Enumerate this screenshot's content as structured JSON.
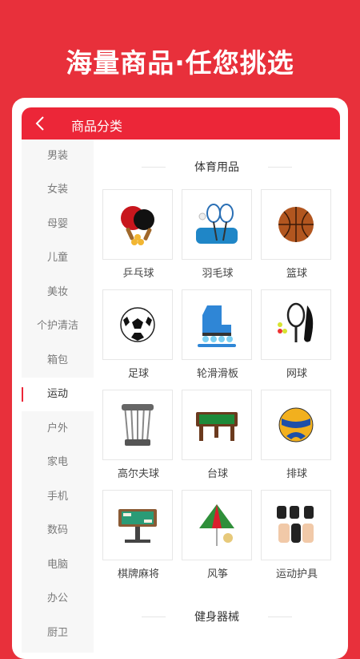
{
  "promo_text": "海量商品·任您挑选",
  "header": {
    "title": "商品分类"
  },
  "sidebar": {
    "items": [
      {
        "label": "男装"
      },
      {
        "label": "女装"
      },
      {
        "label": "母婴"
      },
      {
        "label": "儿童"
      },
      {
        "label": "美妆"
      },
      {
        "label": "个护清洁"
      },
      {
        "label": "箱包"
      },
      {
        "label": "运动",
        "active": true
      },
      {
        "label": "户外"
      },
      {
        "label": "家电"
      },
      {
        "label": "手机"
      },
      {
        "label": "数码"
      },
      {
        "label": "电脑"
      },
      {
        "label": "办公"
      },
      {
        "label": "厨卫"
      }
    ]
  },
  "sections": [
    {
      "title": "体育用品",
      "items": [
        {
          "label": "乒乓球",
          "icon": "ping-pong-icon"
        },
        {
          "label": "羽毛球",
          "icon": "badminton-icon"
        },
        {
          "label": "篮球",
          "icon": "basketball-icon"
        },
        {
          "label": "足球",
          "icon": "soccer-ball-icon"
        },
        {
          "label": "轮滑滑板",
          "icon": "roller-skate-icon"
        },
        {
          "label": "网球",
          "icon": "tennis-icon"
        },
        {
          "label": "高尔夫球",
          "icon": "golf-clubs-icon"
        },
        {
          "label": "台球",
          "icon": "billiard-table-icon"
        },
        {
          "label": "排球",
          "icon": "volleyball-icon"
        },
        {
          "label": "棋牌麻将",
          "icon": "mahjong-table-icon"
        },
        {
          "label": "风筝",
          "icon": "kite-icon"
        },
        {
          "label": "运动护具",
          "icon": "protective-gear-icon"
        }
      ]
    },
    {
      "title": "健身器械",
      "items": []
    }
  ],
  "colors": {
    "accent": "#ec2638",
    "background": "#e8303b"
  }
}
